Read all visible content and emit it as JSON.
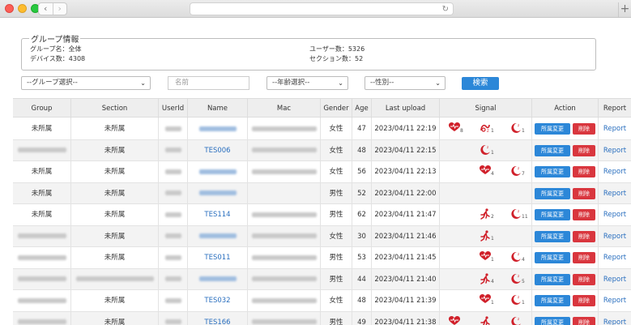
{
  "info": {
    "legend": "グループ情報",
    "group_name": "グループ名：全体",
    "device_count": "デバイス数：4308",
    "user_count": "ユーザー数：5326",
    "session_count": "セクション数：52"
  },
  "filters": {
    "group_select": "--グループ選択--",
    "name_placeholder": "名前",
    "age_select": "--年齢選択--",
    "gender_select": "--性別--",
    "search_label": "検索"
  },
  "table": {
    "headers": [
      "Group",
      "Section",
      "UserId",
      "Name",
      "Mac",
      "Gender",
      "Age",
      "Last upload",
      "Signal",
      "Action",
      "Report"
    ],
    "move_label": "所属変更",
    "delete_label": "削除",
    "report_label": "Report",
    "rows": [
      {
        "group": "未所属",
        "section": "未所属",
        "name": "",
        "gender": "女性",
        "age": "47",
        "last_upload": "2023/04/11 22:19",
        "signals": [
          {
            "icon": "heart-icon",
            "count": "8"
          },
          {
            "icon": "snore-icon",
            "count": "1"
          },
          {
            "icon": "moon-icon",
            "count": "1"
          }
        ]
      },
      {
        "group": "",
        "section": "未所属",
        "name": "TES006",
        "gender": "女性",
        "age": "48",
        "last_upload": "2023/04/11 22:15",
        "signals": [
          {
            "icon": "moon-icon",
            "count": "1"
          }
        ]
      },
      {
        "group": "未所属",
        "section": "未所属",
        "name": "",
        "gender": "女性",
        "age": "56",
        "last_upload": "2023/04/11 22:13",
        "signals": [
          {
            "icon": "heart-icon",
            "count": "4"
          },
          {
            "icon": "moon-icon",
            "count": "7"
          }
        ]
      },
      {
        "group": "未所属",
        "section": "未所属",
        "name": "",
        "gender": "男性",
        "age": "52",
        "last_upload": "2023/04/11 22:00",
        "signals": []
      },
      {
        "group": "未所属",
        "section": "未所属",
        "name": "TES114",
        "gender": "男性",
        "age": "62",
        "last_upload": "2023/04/11 21:47",
        "signals": [
          {
            "icon": "running-icon",
            "count": "2"
          },
          {
            "icon": "moon-icon",
            "count": "11"
          }
        ]
      },
      {
        "group": "",
        "section": "未所属",
        "name": "",
        "gender": "女性",
        "age": "30",
        "last_upload": "2023/04/11 21:46",
        "signals": [
          {
            "icon": "running-icon",
            "count": "1"
          }
        ]
      },
      {
        "group": "",
        "section": "未所属",
        "name": "TES011",
        "gender": "男性",
        "age": "53",
        "last_upload": "2023/04/11 21:45",
        "signals": [
          {
            "icon": "heart-icon",
            "count": "1"
          },
          {
            "icon": "moon-icon",
            "count": "4"
          }
        ]
      },
      {
        "group": "",
        "section": "",
        "name": "",
        "gender": "男性",
        "age": "44",
        "last_upload": "2023/04/11 21:40",
        "signals": [
          {
            "icon": "running-icon",
            "count": "4"
          },
          {
            "icon": "moon-icon",
            "count": "5"
          }
        ]
      },
      {
        "group": "",
        "section": "未所属",
        "name": "TES032",
        "gender": "女性",
        "age": "48",
        "last_upload": "2023/04/11 21:39",
        "signals": [
          {
            "icon": "heart-icon",
            "count": "1"
          },
          {
            "icon": "moon-icon",
            "count": "1"
          }
        ]
      },
      {
        "group": "",
        "section": "未所属",
        "name": "TES166",
        "gender": "男性",
        "age": "49",
        "last_upload": "2023/04/11 21:38",
        "signals": [
          {
            "icon": "heart-icon",
            "count": ""
          },
          {
            "icon": "running-icon",
            "count": ""
          },
          {
            "icon": "moon-icon",
            "count": ""
          }
        ]
      }
    ]
  },
  "colors": {
    "primary_button": "#2c87d8",
    "delete_button": "#d9363e",
    "signal_icon": "#d0202a",
    "link": "#2a6fbf"
  }
}
